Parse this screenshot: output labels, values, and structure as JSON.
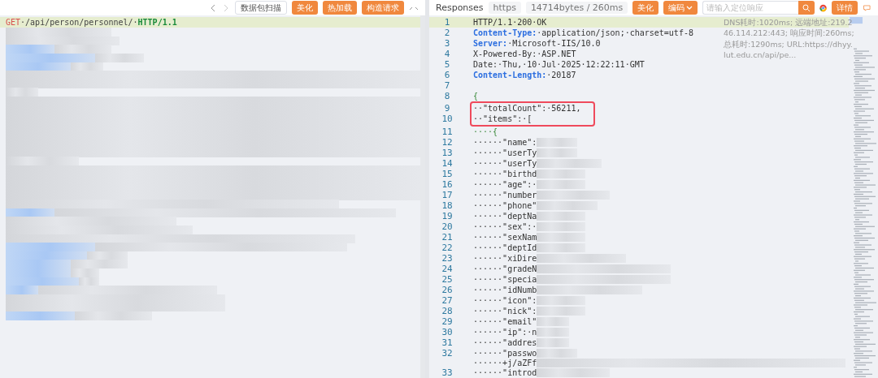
{
  "request_toolbar": {
    "buttons": [
      {
        "label": "数据包扫描",
        "kind": "outline"
      },
      {
        "label": "美化",
        "kind": "primary"
      },
      {
        "label": "热加载",
        "kind": "primary"
      },
      {
        "label": "构造请求",
        "kind": "primary"
      }
    ]
  },
  "request_editor": {
    "method": "GET",
    "path": "·/api/person/personnel/·",
    "version": "HTTP/1.1"
  },
  "response_toolbar": {
    "title": "Responses",
    "protocol": "https",
    "size": "14714bytes / 260ms",
    "buttons": [
      {
        "label": "美化",
        "kind": "primary"
      },
      {
        "label": "编码",
        "kind": "dropdown"
      }
    ],
    "search": {
      "placeholder": "请输入定位响应"
    },
    "details_button": "详情"
  },
  "response_info": [
    "DNS耗时:1020ms; 远端地址:219.2",
    "46.114.212:443; 响应时间:260ms;",
    "总耗时:1290ms; URL:https://dhyy.",
    "lut.edu.cn/api/pe..."
  ],
  "response_lines": [
    {
      "number": "1",
      "kind": "status",
      "text": "HTTP/1.1·200·OK",
      "current": true
    },
    {
      "number": "2",
      "kind": "header",
      "key": "Content-Type:",
      "text": "·application/json;·charset=utf-8"
    },
    {
      "number": "3",
      "kind": "header",
      "key": "Server:",
      "text": "·Microsoft-IIS/10.0"
    },
    {
      "number": "4",
      "kind": "plain",
      "text": "X-Powered-By:·ASP.NET"
    },
    {
      "number": "5",
      "kind": "plain",
      "text": "Date:·Thu,·10·Jul·2025·12:22:11·GMT"
    },
    {
      "number": "6",
      "kind": "header",
      "key": "Content-Length:",
      "text": "·20187"
    },
    {
      "number": "7",
      "kind": "plain"
    },
    {
      "number": "8",
      "kind": "bracket",
      "text": "{"
    },
    {
      "number": "9",
      "kind": "plain",
      "text": "··\"totalCount\":·56211,",
      "boxed": true
    },
    {
      "number": "10",
      "kind": "plain",
      "text": "··\"items\":·[",
      "boxed": true
    },
    {
      "number": "11",
      "kind": "bracket",
      "text": "····{"
    },
    {
      "number": "12",
      "kind": "plain",
      "text": "······\"name\":",
      "redacted": true
    },
    {
      "number": "13",
      "kind": "plain",
      "text": "······\"userTy",
      "redacted": true
    },
    {
      "number": "14",
      "kind": "plain",
      "text": "······\"userTy",
      "redacted": true
    },
    {
      "number": "15",
      "kind": "plain",
      "text": "······\"birthd",
      "redacted": true
    },
    {
      "number": "16",
      "kind": "plain",
      "text": "······\"age\":·",
      "redacted": true
    },
    {
      "number": "17",
      "kind": "plain",
      "text": "······\"number",
      "redacted": true
    },
    {
      "number": "18",
      "kind": "plain",
      "text": "······\"phone\"",
      "redacted": true
    },
    {
      "number": "19",
      "kind": "plain",
      "text": "······\"deptNa",
      "redacted": true
    },
    {
      "number": "20",
      "kind": "plain",
      "text": "······\"sex\":·",
      "redacted": true
    },
    {
      "number": "21",
      "kind": "plain",
      "text": "······\"sexNam",
      "redacted": true
    },
    {
      "number": "22",
      "kind": "plain",
      "text": "······\"deptId",
      "redacted": true
    },
    {
      "number": "23",
      "kind": "plain",
      "text": "······\"xiDire",
      "redacted": true
    },
    {
      "number": "24",
      "kind": "plain",
      "text": "······\"gradeN",
      "redacted": true
    },
    {
      "number": "25",
      "kind": "plain",
      "text": "······\"specia",
      "redacted": true
    },
    {
      "number": "26",
      "kind": "plain",
      "text": "······\"idNumb",
      "redacted": true
    },
    {
      "number": "27",
      "kind": "plain",
      "text": "······\"icon\":",
      "redacted": true
    },
    {
      "number": "28",
      "kind": "plain",
      "text": "······\"nick\":",
      "redacted": true
    },
    {
      "number": "29",
      "kind": "plain",
      "text": "······\"email\"",
      "redacted": true
    },
    {
      "number": "30",
      "kind": "plain",
      "text": "······\"ip\":·n",
      "redacted": true
    },
    {
      "number": "31",
      "kind": "plain",
      "text": "······\"addres",
      "redacted": true
    },
    {
      "number": "32",
      "kind": "plain",
      "text": "······\"passwo",
      "redacted": true
    },
    {
      "kind": "plain",
      "text": "······+j/aZFf",
      "redacted": true
    },
    {
      "number": "33",
      "kind": "plain",
      "text": "······\"introd",
      "redacted": true
    }
  ]
}
